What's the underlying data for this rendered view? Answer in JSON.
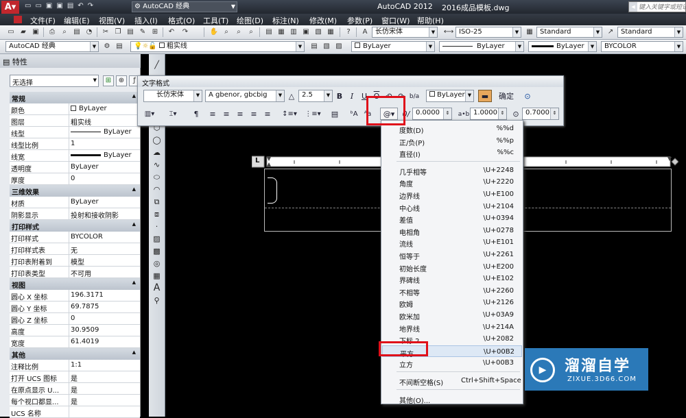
{
  "titlebar": {
    "workspace": "AutoCAD 经典",
    "app": "AutoCAD 2012",
    "file": "2016成品模板.dwg",
    "search_placeholder": "键入关键字或短语"
  },
  "menubar": {
    "items": [
      "文件(F)",
      "编辑(E)",
      "视图(V)",
      "插入(I)",
      "格式(O)",
      "工具(T)",
      "绘图(D)",
      "标注(N)",
      "修改(M)",
      "参数(P)",
      "窗口(W)",
      "帮助(H)"
    ]
  },
  "toolbar1": {
    "text_style": "长仿宋体",
    "dim_style": "ISO-25",
    "table_style": "Standard",
    "mleader_style": "Standard"
  },
  "toolbar2": {
    "workspace": "AutoCAD 经典",
    "layer": "粗实线",
    "color": "ByLayer",
    "linetype": "ByLayer",
    "lineweight": "ByLayer",
    "plotstyle": "BYCOLOR"
  },
  "properties": {
    "title": "特性",
    "selection": "无选择",
    "sections": [
      {
        "title": "常规",
        "rows": [
          [
            "颜色",
            "ByLayer"
          ],
          [
            "图层",
            "粗实线"
          ],
          [
            "线型",
            "ByLayer"
          ],
          [
            "线型比例",
            "1"
          ],
          [
            "线宽",
            "ByLayer"
          ],
          [
            "透明度",
            "ByLayer"
          ],
          [
            "厚度",
            "0"
          ]
        ]
      },
      {
        "title": "三维效果",
        "rows": [
          [
            "材质",
            "ByLayer"
          ],
          [
            "阴影显示",
            "投射和接收阴影"
          ]
        ]
      },
      {
        "title": "打印样式",
        "rows": [
          [
            "打印样式",
            "BYCOLOR"
          ],
          [
            "打印样式表",
            "无"
          ],
          [
            "打印表附着到",
            "模型"
          ],
          [
            "打印表类型",
            "不可用"
          ]
        ]
      },
      {
        "title": "视图",
        "rows": [
          [
            "圆心 X 坐标",
            "196.3171"
          ],
          [
            "圆心 Y 坐标",
            "69.7875"
          ],
          [
            "圆心 Z 坐标",
            "0"
          ],
          [
            "高度",
            "30.9509"
          ],
          [
            "宽度",
            "61.4019"
          ]
        ]
      },
      {
        "title": "其他",
        "rows": [
          [
            "注释比例",
            "1:1"
          ],
          [
            "打开 UCS 图标",
            "是"
          ],
          [
            "在原点显示 U...",
            "是"
          ],
          [
            "每个视口都显...",
            "是"
          ],
          [
            "UCS 名称",
            ""
          ]
        ]
      }
    ]
  },
  "text_format": {
    "title": "文字格式",
    "style": "长仿宋体",
    "font": "gbenor, gbcbig",
    "height": "2.5",
    "color": "ByLayer",
    "ok": "确定",
    "oblique": "0.0000",
    "tracking": "1.0000",
    "width_factor": "0.7000",
    "bold": "B",
    "italic": "I",
    "underline": "U",
    "overline": "O",
    "stack": "b/a",
    "symbol_button": "@▾",
    "ruler_L": "L"
  },
  "symbol_menu": {
    "items": [
      {
        "label": "度数(D)",
        "code": "%%d"
      },
      {
        "label": "正/负(P)",
        "code": "%%p"
      },
      {
        "label": "直径(I)",
        "code": "%%c"
      },
      {
        "label": "几乎相等",
        "code": "\\U+2248"
      },
      {
        "label": "角度",
        "code": "\\U+2220"
      },
      {
        "label": "边界线",
        "code": "\\U+E100"
      },
      {
        "label": "中心线",
        "code": "\\U+2104"
      },
      {
        "label": "差值",
        "code": "\\U+0394"
      },
      {
        "label": "电相角",
        "code": "\\U+0278"
      },
      {
        "label": "流线",
        "code": "\\U+E101"
      },
      {
        "label": "恒等于",
        "code": "\\U+2261"
      },
      {
        "label": "初始长度",
        "code": "\\U+E200"
      },
      {
        "label": "界碑线",
        "code": "\\U+E102"
      },
      {
        "label": "不相等",
        "code": "\\U+2260"
      },
      {
        "label": "欧姆",
        "code": "\\U+2126"
      },
      {
        "label": "欧米加",
        "code": "\\U+03A9"
      },
      {
        "label": "地界线",
        "code": "\\U+214A"
      },
      {
        "label": "下标 2",
        "code": "\\U+2082"
      },
      {
        "label": "平方",
        "code": "\\U+00B2"
      },
      {
        "label": "立方",
        "code": "\\U+00B3"
      },
      {
        "label": "不间断空格(S)",
        "code": "Ctrl+Shift+Space"
      },
      {
        "label": "其他(O)...",
        "code": ""
      }
    ]
  },
  "watermark": {
    "brand": "溜溜自学",
    "url": "ZIXUE.3D66.COM"
  },
  "colors": {
    "highlight": "#e0101a",
    "canvas": "#000000",
    "watermark": "#2b79b8"
  }
}
